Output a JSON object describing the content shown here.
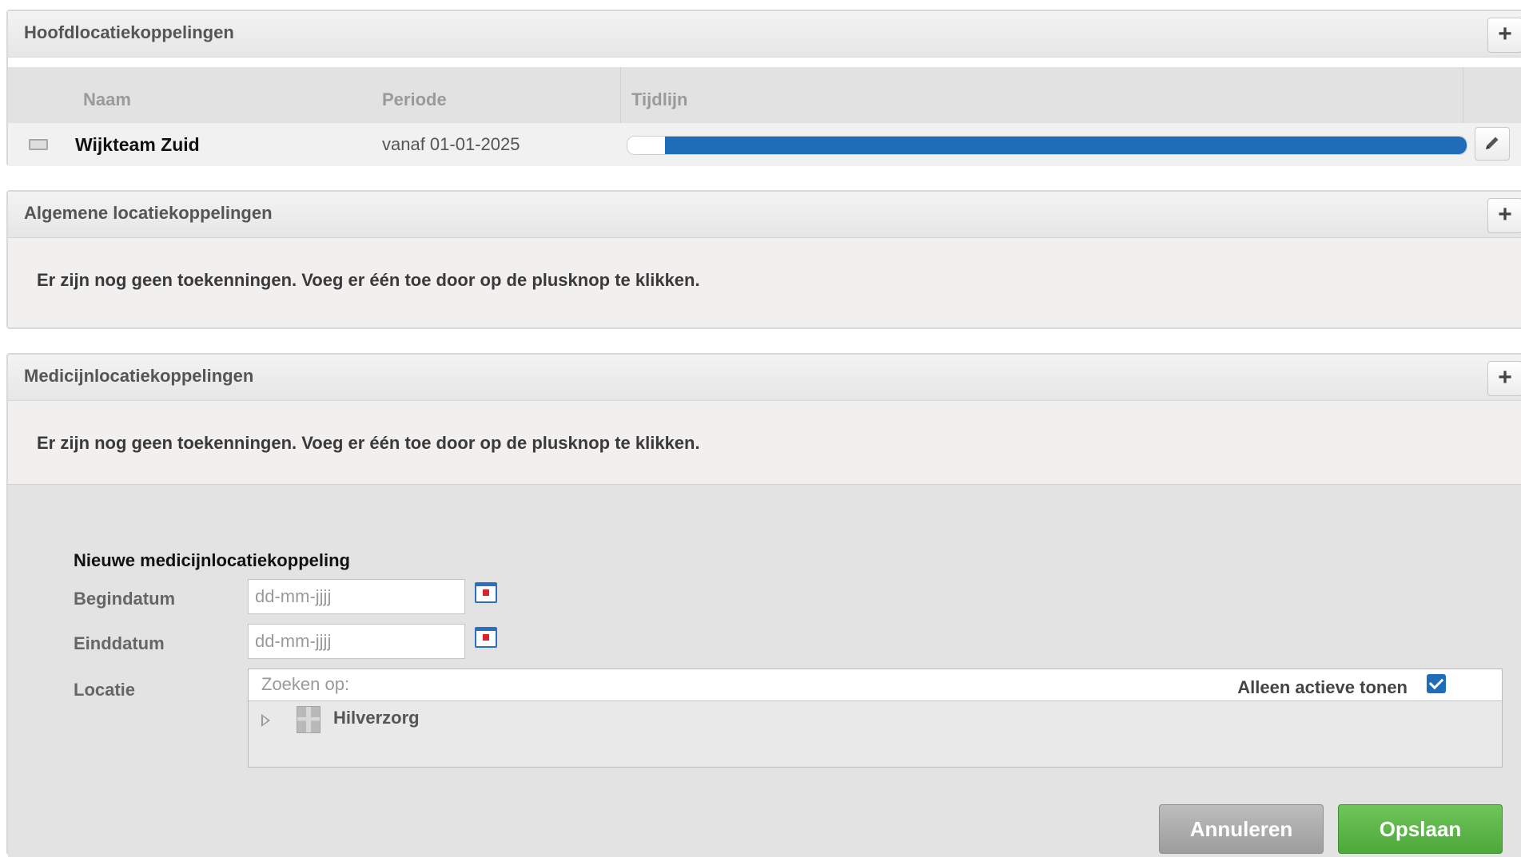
{
  "main_location": {
    "title": "Hoofdlocatiekoppelingen",
    "add_label": "+",
    "columns": {
      "name": "Naam",
      "period": "Periode",
      "timeline": "Tijdlijn"
    },
    "rows": [
      {
        "name": "Wijkteam Zuid",
        "period": "vanaf 01-01-2025",
        "timeline_active_fraction": 0.955
      }
    ]
  },
  "general_location": {
    "title": "Algemene locatiekoppelingen",
    "add_label": "+",
    "empty_message": "Er zijn nog geen toekenningen. Voeg er één toe door op de plusknop te klikken."
  },
  "medicine_location": {
    "title": "Medicijnlocatiekoppelingen",
    "add_label": "+",
    "empty_message": "Er zijn nog geen toekenningen. Voeg er één toe door op de plusknop te klikken."
  },
  "new_form": {
    "title": "Nieuwe medicijnlocatiekoppeling",
    "start_label": "Begindatum",
    "start_placeholder": "dd-mm-jjjj",
    "end_label": "Einddatum",
    "end_placeholder": "dd-mm-jjjj",
    "location_label": "Locatie",
    "search_placeholder": "Zoeken op:",
    "active_only_label": "Alleen actieve tonen",
    "active_only_checked": true,
    "tree_items": [
      {
        "label": "Hilverzorg",
        "icon": "building-icon"
      }
    ],
    "cancel_label": "Annuleren",
    "save_label": "Opslaan"
  },
  "colors": {
    "timeline_bar": "#1f6db8",
    "save_button": "#4da83a",
    "cancel_button": "#9d9d9d"
  }
}
